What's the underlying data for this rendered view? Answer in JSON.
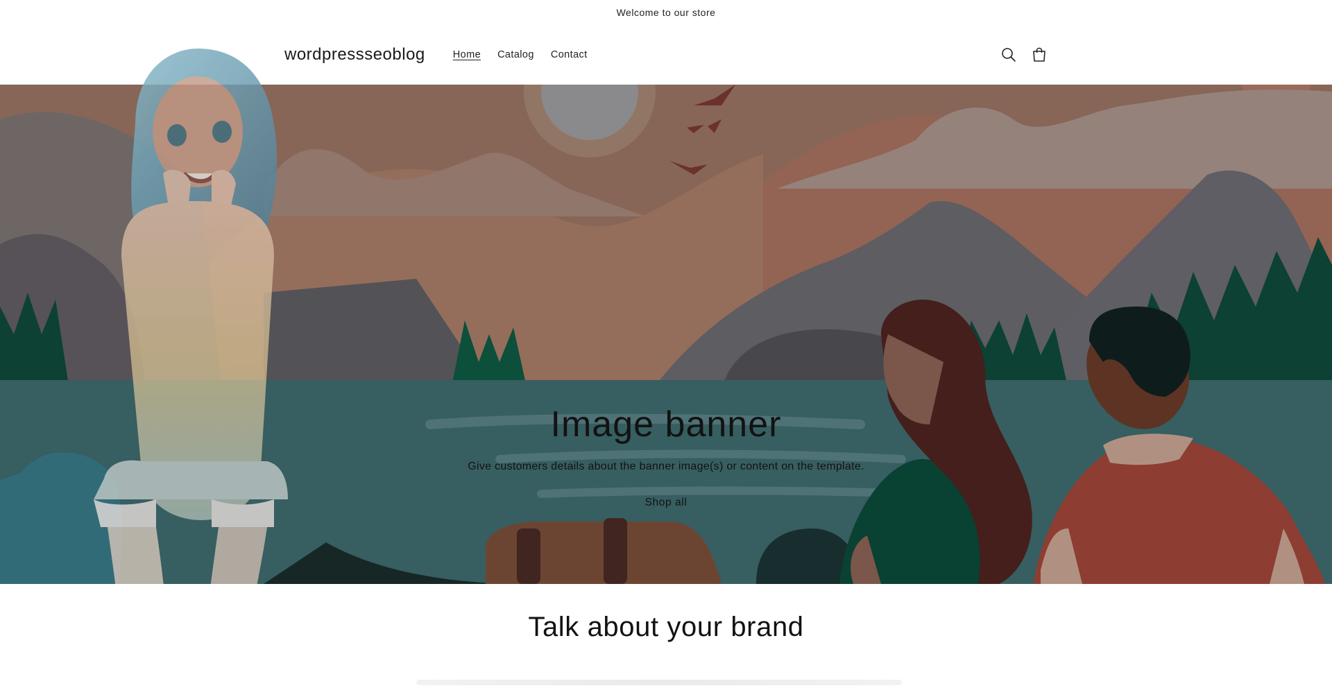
{
  "announcement": {
    "text": "Welcome to our store"
  },
  "header": {
    "logo": "wordpressseoblog",
    "nav": [
      {
        "label": "Home",
        "active": true
      },
      {
        "label": "Catalog",
        "active": false
      },
      {
        "label": "Contact",
        "active": false
      }
    ],
    "icons": [
      "search-icon",
      "cart-icon"
    ]
  },
  "banner": {
    "title": "Image banner",
    "text": "Give customers details about the banner image(s) or content on the template.",
    "button": "Shop all"
  },
  "brand": {
    "title": "Talk about your brand"
  },
  "colors": {
    "sky": "#9a7563",
    "water": "#3f6b6e",
    "forest": "#0e4a3c",
    "mountain": "#5f5e63"
  }
}
